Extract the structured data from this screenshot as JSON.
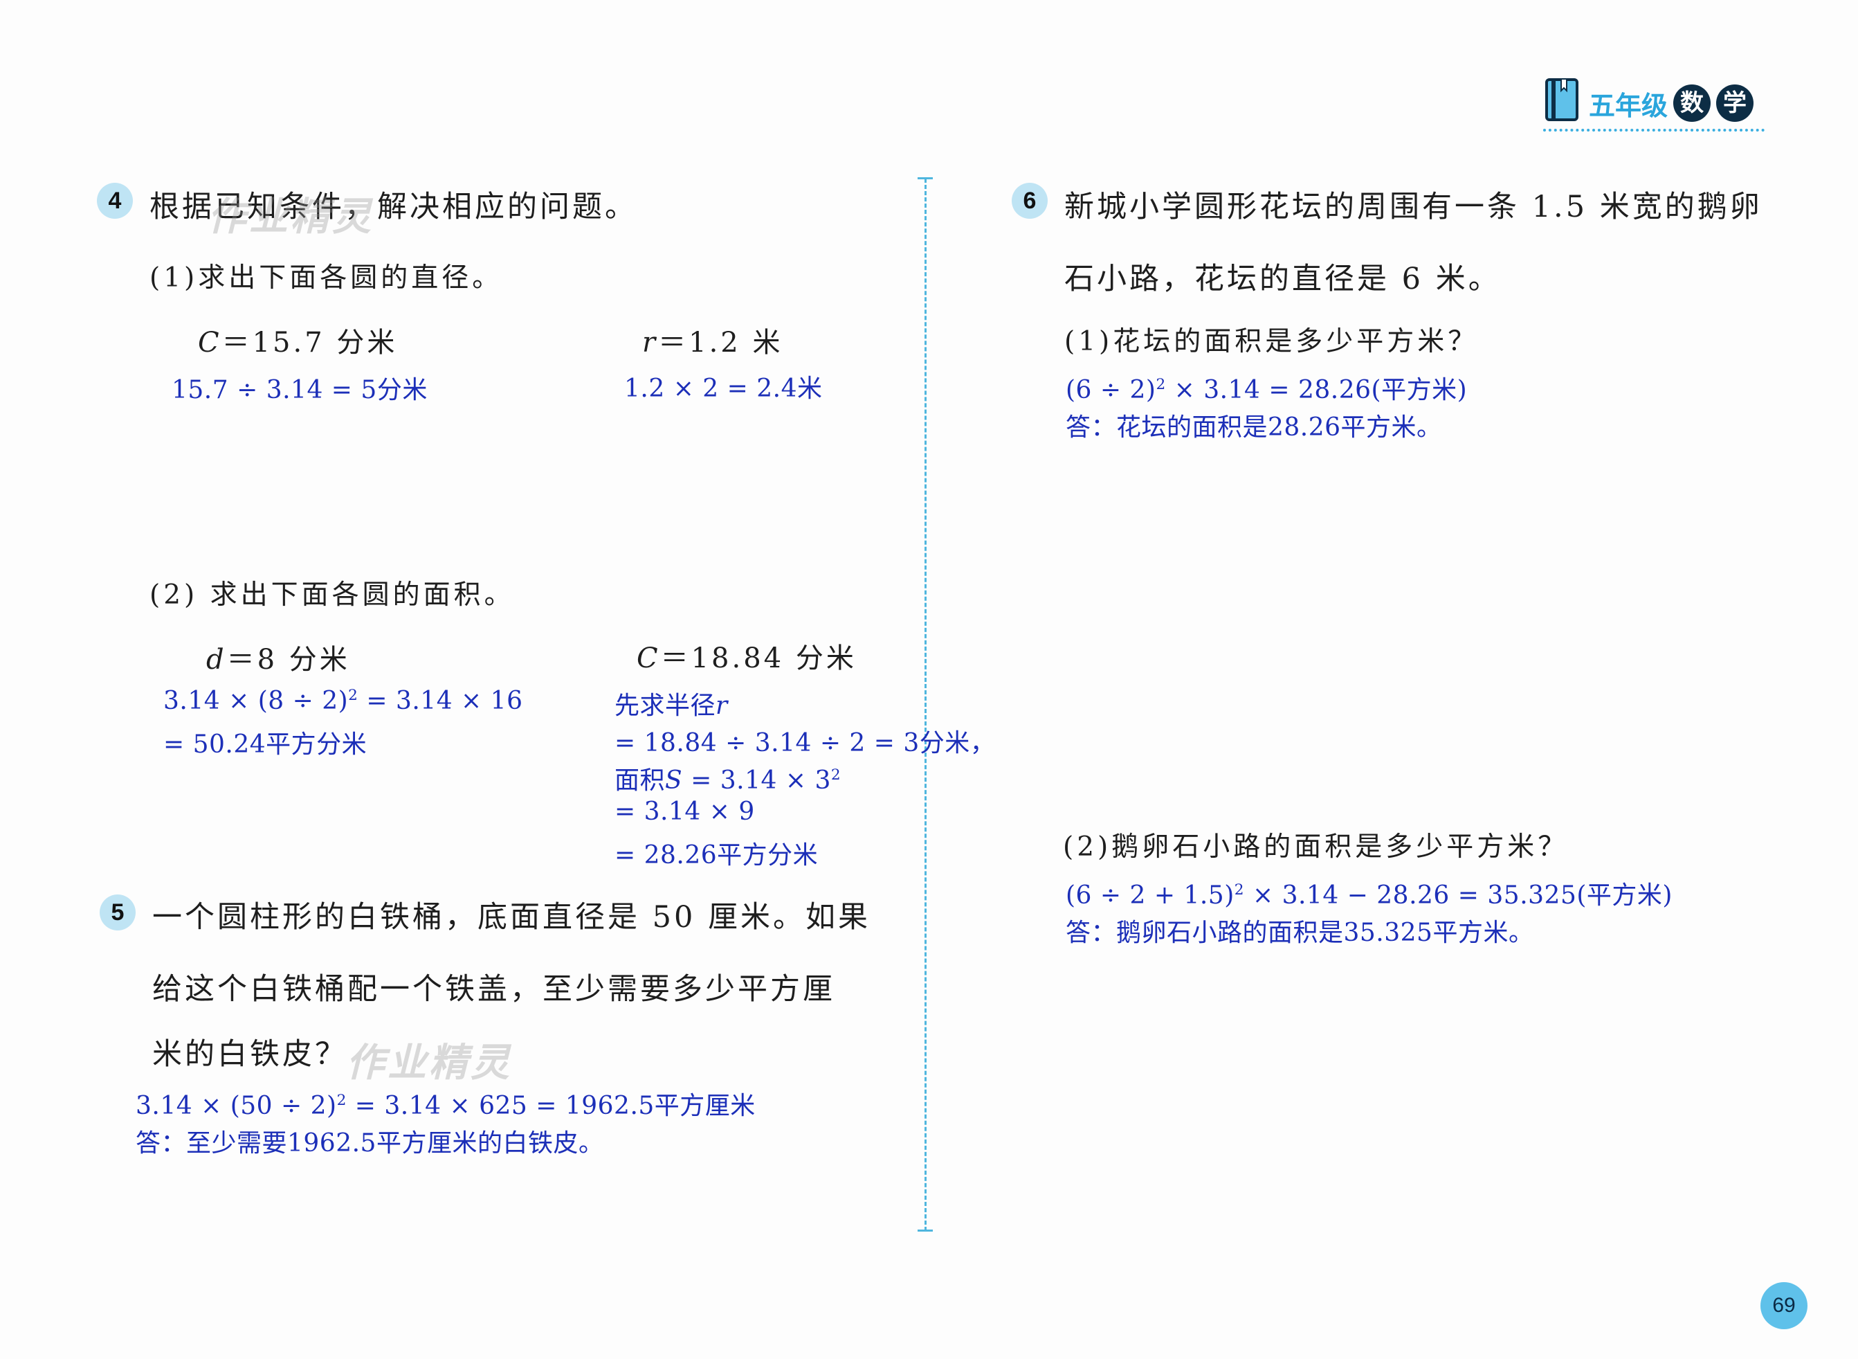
{
  "header": {
    "grade": "五年级",
    "subject_char1": "数",
    "subject_char2": "学",
    "accent_color": "#3aaee0"
  },
  "page_number": "69",
  "watermark": "作业精灵",
  "q4": {
    "number": "4",
    "prompt": "根据已知条件，解决相应的问题。",
    "part1": {
      "label": "(1)求出下面各圆的直径。",
      "a_given_var": "C",
      "a_given_rest": "＝15.7 分米",
      "a_answer": "15.7 ÷ 3.14 = 5分米",
      "b_given_var": "r",
      "b_given_rest": "＝1.2 米",
      "b_answer": "1.2 × 2 = 2.4米"
    },
    "part2": {
      "label": "(2) 求出下面各圆的面积。",
      "a_given_var": "d",
      "a_given_rest": "＝8 分米",
      "a_answer_line1_pre": "3.14 × (8 ÷ 2)",
      "a_answer_line1_sup": "2",
      "a_answer_line1_post": " = 3.14 × 16",
      "a_answer_line2": "= 50.24平方分米",
      "b_given_var": "C",
      "b_given_rest": "＝18.84 分米",
      "b_answer_line1_pre": "先求半径",
      "b_answer_line1_var": "r",
      "b_answer_line2": "= 18.84 ÷ 3.14 ÷ 2 = 3分米，",
      "b_answer_line3_pre": "面积",
      "b_answer_line3_var": "S",
      "b_answer_line3_post": " = 3.14 × 3",
      "b_answer_line3_sup": "2",
      "b_answer_line4": "= 3.14 × 9",
      "b_answer_line5": "= 28.26平方分米"
    }
  },
  "q5": {
    "number": "5",
    "prompt_line1": "一个圆柱形的白铁桶，底面直径是 50 厘米。如果",
    "prompt_line2": "给这个白铁桶配一个铁盖，至少需要多少平方厘",
    "prompt_line3": "米的白铁皮？",
    "answer_line1_pre": "3.14 × (50 ÷ 2)",
    "answer_line1_sup": "2",
    "answer_line1_post": " = 3.14 × 625 = 1962.5平方厘米",
    "answer_line2": "答：至少需要1962.5平方厘米的白铁皮。"
  },
  "q6": {
    "number": "6",
    "prompt_line1": "新城小学圆形花坛的周围有一条 1.5 米宽的鹅卵",
    "prompt_line2": "石小路，花坛的直径是 6 米。",
    "part1": {
      "label": "(1)花坛的面积是多少平方米？",
      "answer_line1_pre": "(6 ÷ 2)",
      "answer_line1_sup": "2",
      "answer_line1_post": " × 3.14 = 28.26(平方米)",
      "answer_line2": "答：花坛的面积是28.26平方米。"
    },
    "part2": {
      "label": "(2)鹅卵石小路的面积是多少平方米？",
      "answer_line1_pre": "(6 ÷ 2 + 1.5)",
      "answer_line1_sup": "2",
      "answer_line1_post": " × 3.14 − 28.26 = 35.325(平方米)",
      "answer_line2": "答：鹅卵石小路的面积是35.325平方米。"
    }
  }
}
